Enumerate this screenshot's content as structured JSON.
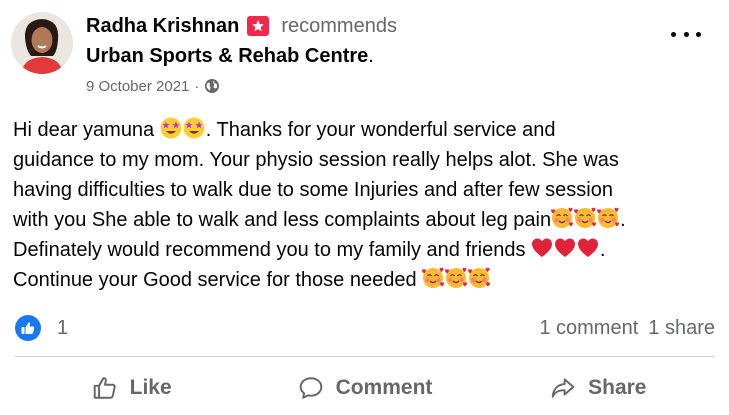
{
  "post": {
    "author": "Radha Krishnan",
    "action": "recommends",
    "page": "Urban Sports & Rehab Centre",
    "page_suffix": ".",
    "date": "9 October 2021",
    "separator": "·",
    "icons": {
      "badge": "star-badge-icon",
      "privacy": "globe-icon",
      "menu": "more-options-icon"
    },
    "colors": {
      "badge": "#f02849",
      "like": "#1877f2",
      "heart": "#e0223a"
    }
  },
  "body": {
    "line1_a": "Hi dear yamuna ",
    "line1_b": ". Thanks for your wonderful service and",
    "line2": "guidance to my mom. Your physio session really helps alot. She was",
    "line3": "having difficulties to walk due to some Injuries and after few session",
    "line4_a": "with you She able to walk and less complaints about leg pain",
    "line4_b": ".",
    "line5_a": "Definately would recommend you to my family and friends ",
    "line5_b": ".",
    "line6": "Continue your Good service for those needed ",
    "emoji": {
      "star_eyes": "star-struck-emoji",
      "hearts_face": "smiling-face-with-hearts-emoji",
      "heart": "red-heart-emoji"
    }
  },
  "stats": {
    "likes": "1",
    "comments": "1 comment",
    "shares": "1 share"
  },
  "actions": {
    "like": "Like",
    "comment": "Comment",
    "share": "Share"
  }
}
